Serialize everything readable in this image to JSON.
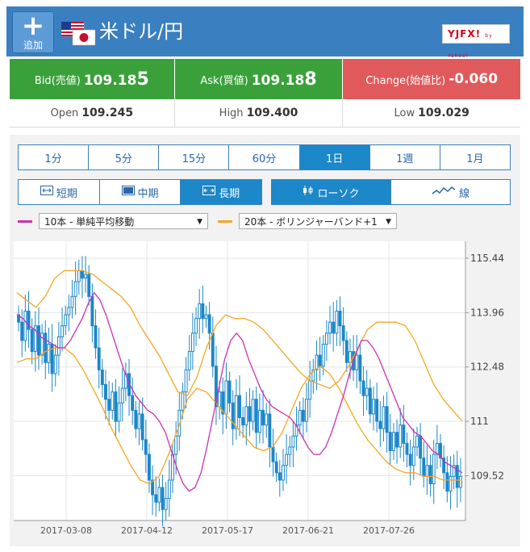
{
  "header": {
    "add_label": "追加",
    "pair_name": "米ドル/円",
    "brand": "YJFX!",
    "brand_sub": "by Yahoo!",
    "colors": {
      "bar": "#3a7fc0",
      "button": "#5c9bd6"
    }
  },
  "quotes": {
    "bid_label": "Bid(売値)",
    "bid_value_main": "109.18",
    "bid_value_tail": "5",
    "ask_label": "Ask(買値)",
    "ask_value_main": "109.18",
    "ask_value_tail": "8",
    "change_label": "Change(始値比)",
    "change_value": "-0.060",
    "colors": {
      "up": "#3aa13a",
      "down": "#e05a5c"
    }
  },
  "stats": {
    "open_label": "Open",
    "open_value": "109.245",
    "high_label": "High",
    "high_value": "109.400",
    "low_label": "Low",
    "low_value": "109.029"
  },
  "timeframes": [
    {
      "label": "1分",
      "active": false
    },
    {
      "label": "5分",
      "active": false
    },
    {
      "label": "15分",
      "active": false
    },
    {
      "label": "60分",
      "active": false
    },
    {
      "label": "1日",
      "active": true
    },
    {
      "label": "1週",
      "active": false
    },
    {
      "label": "1月",
      "active": false
    }
  ],
  "terms": [
    {
      "label": "短期",
      "icon": "narrow-range-icon",
      "active": false
    },
    {
      "label": "中期",
      "icon": "medium-range-icon",
      "active": false
    },
    {
      "label": "長期",
      "icon": "wide-range-icon",
      "active": true
    }
  ],
  "chart_styles": [
    {
      "label": "ローソク",
      "icon": "candlestick-icon",
      "active": true
    },
    {
      "label": "線",
      "icon": "line-chart-icon",
      "active": false
    }
  ],
  "indicators": {
    "ma": {
      "label": "10本 - 単純平均移動",
      "color": "#cc2fb4"
    },
    "bb": {
      "label": "20本 - ボリンジャーバンド+1",
      "color": "#f5a623"
    }
  },
  "chart_data": {
    "type": "candlestick",
    "x_ticks": [
      "2017-03-08",
      "2017-04-12",
      "2017-05-17",
      "2017-06-21",
      "2017-07-26"
    ],
    "y_ticks": [
      "115.44",
      "113.96",
      "112.48",
      "111",
      "109.52"
    ],
    "ylim": [
      108.3,
      115.9
    ],
    "close": [
      113.7,
      113.2,
      114.0,
      113.5,
      112.9,
      113.6,
      112.8,
      113.4,
      112.6,
      113.1,
      112.3,
      112.8,
      113.3,
      113.6,
      113.9,
      114.1,
      114.4,
      114.8,
      115.1,
      114.9,
      115.0,
      114.4,
      113.6,
      113.0,
      112.4,
      112.0,
      111.6,
      111.3,
      111.8,
      111.0,
      111.5,
      111.9,
      112.3,
      111.7,
      111.3,
      110.8,
      111.2,
      110.5,
      110.1,
      109.4,
      109.0,
      108.8,
      109.2,
      108.6,
      108.9,
      109.4,
      110.1,
      110.6,
      111.3,
      111.8,
      112.4,
      112.9,
      113.4,
      113.8,
      114.2,
      113.8,
      113.9,
      113.4,
      112.5,
      111.4,
      111.8,
      111.2,
      112.1,
      111.5,
      110.8,
      111.7,
      111.1,
      110.9,
      111.4,
      111.0,
      111.6,
      110.7,
      111.3,
      110.9,
      111.2,
      110.3,
      109.9,
      109.6,
      109.4,
      109.8,
      110.1,
      110.3,
      110.6,
      110.9,
      111.3,
      111.0,
      111.6,
      112.1,
      112.4,
      112.8,
      112.5,
      113.1,
      113.4,
      113.7,
      113.4,
      114.0,
      113.6,
      113.2,
      112.6,
      112.9,
      112.4,
      112.8,
      112.1,
      111.7,
      111.9,
      111.2,
      111.6,
      111.0,
      110.8,
      111.4,
      110.7,
      110.2,
      110.7,
      110.3,
      110.9,
      110.4,
      110.1,
      109.8,
      110.3,
      110.6,
      110.0,
      109.5,
      109.8,
      109.3,
      110.1,
      110.4,
      110.0,
      109.6,
      109.1,
      109.5,
      109.8,
      109.2,
      109.5
    ],
    "ma_line": [
      113.9,
      113.8,
      113.6,
      113.5,
      113.3,
      113.2,
      113.1,
      113.0,
      113.0,
      113.2,
      113.5,
      113.8,
      114.2,
      114.5,
      114.3,
      113.9,
      113.4,
      112.9,
      112.4,
      112.0,
      111.7,
      111.5,
      111.3,
      111.2,
      111.0,
      110.7,
      110.2,
      109.7,
      109.3,
      109.1,
      109.2,
      109.6,
      110.3,
      111.1,
      111.9,
      112.7,
      113.2,
      113.4,
      113.2,
      112.7,
      112.3,
      111.9,
      111.6,
      111.4,
      111.3,
      111.2,
      111.1,
      110.9,
      110.6,
      110.3,
      110.1,
      110.1,
      110.3,
      110.7,
      111.2,
      111.7,
      112.3,
      112.8,
      113.2,
      113.2,
      113.0,
      112.7,
      112.3,
      111.9,
      111.5,
      111.1,
      110.9,
      110.7,
      110.6,
      110.4,
      110.2,
      110.1,
      109.9,
      109.8,
      109.7,
      109.6
    ],
    "bb_upper": [
      114.5,
      114.3,
      114.1,
      114.4,
      114.9,
      115.1,
      115.1,
      115.1,
      115.0,
      114.8,
      114.6,
      114.4,
      114.1,
      113.6,
      113.2,
      112.8,
      112.3,
      111.8,
      111.7,
      112.2,
      113.0,
      113.6,
      113.9,
      113.8,
      113.8,
      113.7,
      113.5,
      113.2,
      112.9,
      112.6,
      112.3,
      112.1,
      112.0,
      111.9,
      112.1,
      112.5,
      113.0,
      113.5,
      113.7,
      113.7,
      113.7,
      113.6,
      113.2,
      112.6,
      112.0,
      111.6,
      111.3,
      111.0
    ],
    "bb_lower": [
      112.6,
      112.7,
      112.7,
      112.9,
      113.0,
      113.0,
      112.8,
      112.4,
      111.9,
      111.4,
      110.8,
      110.3,
      109.8,
      109.4,
      109.3,
      109.5,
      110.1,
      110.8,
      111.6,
      111.9,
      111.8,
      111.5,
      111.2,
      110.9,
      110.6,
      110.3,
      110.2,
      110.3,
      110.7,
      111.3,
      111.9,
      112.3,
      112.5,
      112.3,
      111.9,
      111.4,
      110.9,
      110.5,
      110.2,
      109.9,
      109.7,
      109.6,
      109.6,
      109.5,
      109.5,
      109.4,
      109.4,
      109.4
    ],
    "candle_color": "#1c87c9",
    "grid": true
  }
}
